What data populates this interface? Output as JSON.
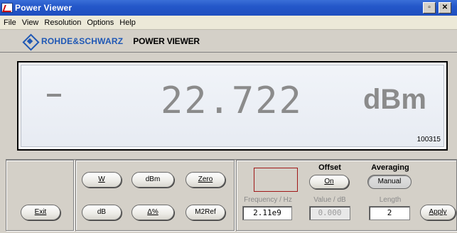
{
  "window": {
    "title": "Power Viewer"
  },
  "menu": {
    "items": [
      "File",
      "View",
      "Resolution",
      "Options",
      "Help"
    ]
  },
  "brand": {
    "company": "ROHDE&SCHWARZ",
    "product": "POWER VIEWER"
  },
  "display": {
    "sign": "-",
    "value": "22.722",
    "unit": "dBm",
    "serial": "100315"
  },
  "buttons": {
    "exit": "Exit",
    "w": "W",
    "dbm": "dBm",
    "zero": "Zero",
    "db": "dB",
    "delta_pct": "Δ%",
    "m2ref": "M2Ref",
    "offset_on": "On",
    "manual": "Manual",
    "apply": "Apply"
  },
  "offset": {
    "heading": "Offset",
    "value_label": "Value / dB",
    "value": "0.000"
  },
  "averaging": {
    "heading": "Averaging",
    "length_label": "Length",
    "length": "2"
  },
  "frequency": {
    "label": "Frequency / Hz",
    "value": "2.11e9"
  }
}
